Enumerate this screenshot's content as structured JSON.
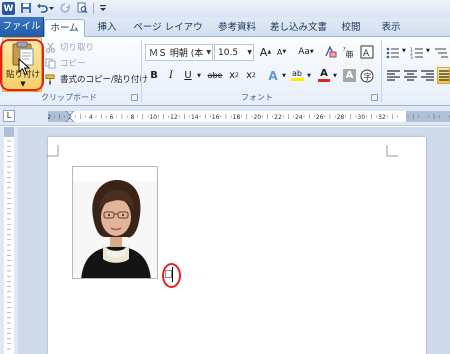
{
  "titlebar": {
    "app_logo_text": "W",
    "icons": [
      "save-icon",
      "undo-icon",
      "undo-dropdown-icon",
      "redo-icon",
      "print-preview-icon",
      "customize-dropdown-icon"
    ]
  },
  "tabs": {
    "file": "ファイル",
    "home": "ホーム",
    "insert": "挿入",
    "page_layout": "ページ レイアウト",
    "references": "参考資料",
    "mailings": "差し込み文書",
    "review": "校閲",
    "view": "表示"
  },
  "clipboard": {
    "paste_label": "貼り付け",
    "cut_label": "切り取り",
    "copy_label": "コピー",
    "format_painter_label": "書式のコピー/貼り付け",
    "group_label": "クリップボード"
  },
  "font": {
    "font_name": "ＭＳ 明朝 (本",
    "font_size": "10.5",
    "grow_label": "A",
    "shrink_label": "A",
    "change_case_label": "Aa",
    "bold_label": "B",
    "italic_label": "I",
    "underline_label": "U",
    "strikethrough_label": "abe",
    "subscript_label": "x",
    "superscript_label": "x",
    "text_effects_label": "A",
    "highlight_label": "ab",
    "font_color_label": "A",
    "char_shading_label": "A",
    "group_label": "フォント"
  },
  "ruler": {
    "numbers": [
      "2",
      "2",
      "4",
      "6",
      "8",
      "10",
      "12",
      "14",
      "16",
      "18",
      "20",
      "22",
      "24",
      "26",
      "28",
      "30",
      "32"
    ]
  },
  "colors": {
    "accent_blue": "#2b579a",
    "highlight_ring": "#e0241d",
    "font_color_red": "#e0241d",
    "highlight_yellow": "#ffee00"
  }
}
